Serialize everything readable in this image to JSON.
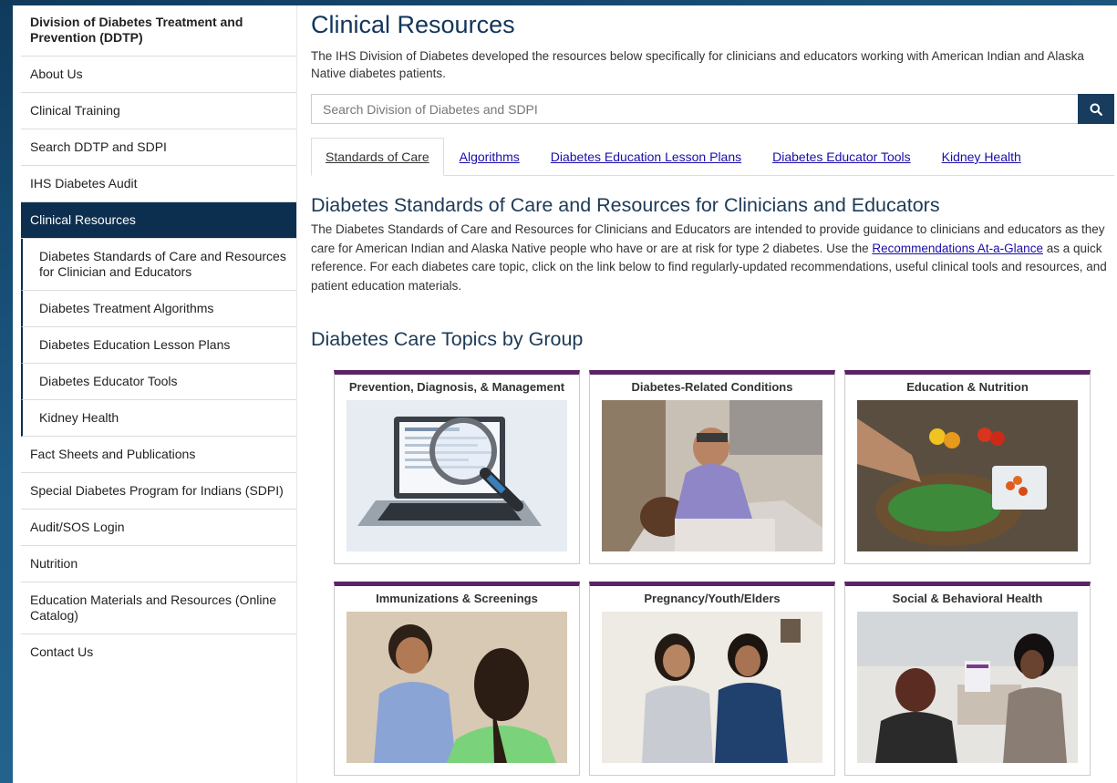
{
  "sidebar": {
    "title": "Division of Diabetes Treatment and Prevention (DDTP)",
    "items": [
      {
        "label": "About Us"
      },
      {
        "label": "Clinical Training"
      },
      {
        "label": "Search DDTP and SDPI"
      },
      {
        "label": "IHS Diabetes Audit"
      },
      {
        "label": "Clinical Resources"
      }
    ],
    "subitems": [
      {
        "label": "Diabetes Standards of Care and Resources for Clinician and Educators"
      },
      {
        "label": "Diabetes Treatment Algorithms"
      },
      {
        "label": "Diabetes Education Lesson Plans"
      },
      {
        "label": "Diabetes Educator Tools"
      },
      {
        "label": "Kidney Health"
      }
    ],
    "items_after": [
      {
        "label": "Fact Sheets and Publications"
      },
      {
        "label": "Special Diabetes Program for Indians (SDPI)"
      },
      {
        "label": "Audit/SOS Login"
      },
      {
        "label": "Nutrition"
      },
      {
        "label": "Education Materials and Resources (Online Catalog)"
      },
      {
        "label": "Contact Us"
      }
    ]
  },
  "main": {
    "title": "Clinical Resources",
    "intro": "The IHS Division of Diabetes developed the resources below specifically for clinicians and educators working with American Indian and Alaska Native diabetes patients.",
    "search": {
      "placeholder": "Search Division of Diabetes and SDPI",
      "icon": "search-icon"
    },
    "tabs": [
      {
        "label": "Standards of Care"
      },
      {
        "label": "Algorithms"
      },
      {
        "label": "Diabetes Education Lesson Plans"
      },
      {
        "label": "Diabetes Educator Tools"
      },
      {
        "label": "Kidney Health"
      }
    ],
    "section_title": "Diabetes Standards of Care and Resources for Clinicians and Educators",
    "section_text_before": "The Diabetes Standards of Care and Resources for Clinicians and Educators are intended to provide guidance to clinicians and educators as they care for American Indian and Alaska Native people who have or are at risk for type 2 diabetes. Use the ",
    "section_link": "Recommendations At-a-Glance",
    "section_text_after": " as a quick reference. For each diabetes care topic, click on the link below to find regularly-updated recommendations, useful clinical tools and resources, and patient education materials.",
    "topics_title": "Diabetes Care Topics by Group",
    "cards": [
      {
        "title": "Prevention, Diagnosis, & Management"
      },
      {
        "title": "Diabetes-Related Conditions"
      },
      {
        "title": "Education & Nutrition"
      },
      {
        "title": "Immunizations & Screenings"
      },
      {
        "title": "Pregnancy/Youth/Elders"
      },
      {
        "title": "Social & Behavioral Health"
      }
    ]
  },
  "colors": {
    "navy": "#0d2f4f",
    "card_accent": "#5a2466",
    "link": "#1a0dab"
  }
}
